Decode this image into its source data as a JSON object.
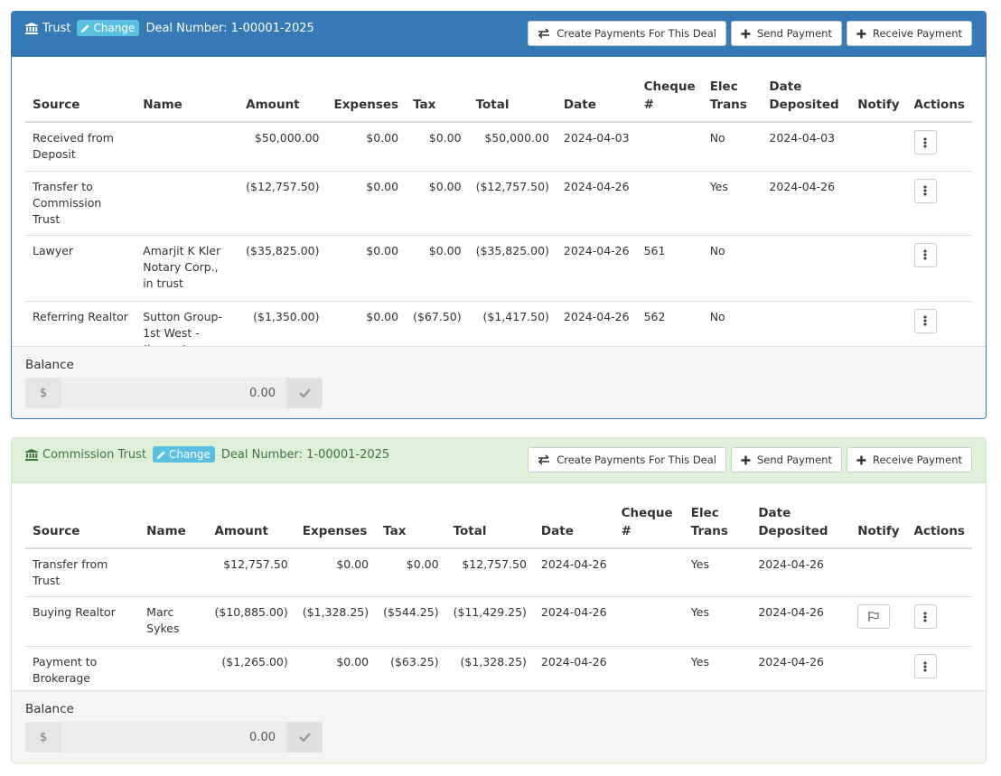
{
  "panels": [
    {
      "heading": {
        "account_name": "Trust",
        "change_label": "Change",
        "deal_number": "Deal Number: 1-00001-2025",
        "buttons": {
          "create_payments": "Create Payments For This Deal",
          "send_payment": "Send Payment",
          "receive_payment": "Receive Payment"
        }
      },
      "columns": [
        "Source",
        "Name",
        "Amount",
        "Expenses",
        "Tax",
        "Total",
        "Date",
        "Cheque #",
        "Elec Trans",
        "Date Deposited",
        "Notify",
        "Actions"
      ],
      "column_lines": {
        "cheque_1": "Cheque",
        "cheque_2": "#",
        "elec_1": "Elec",
        "elec_2": "Trans",
        "deposited_1": "Date",
        "deposited_2": "Deposited"
      },
      "rows": [
        {
          "source": "Received from Deposit",
          "name": "",
          "name_agent": "",
          "amount": "$50,000.00",
          "expenses": "$0.00",
          "tax": "$0.00",
          "total": "$50,000.00",
          "date": "2024-04-03",
          "cheque": "",
          "elec_trans": "No",
          "date_deposited": "2024-04-03",
          "notify": false
        },
        {
          "source": "Transfer to Commission Trust",
          "name": "",
          "name_agent": "",
          "amount": "($12,757.50)",
          "expenses": "$0.00",
          "tax": "$0.00",
          "total": "($12,757.50)",
          "date": "2024-04-26",
          "cheque": "",
          "elec_trans": "Yes",
          "date_deposited": "2024-04-26",
          "notify": false
        },
        {
          "source": "Lawyer",
          "name": "Amarjit K Kler Notary Corp., in trust",
          "name_agent": "",
          "amount": "($35,825.00)",
          "expenses": "$0.00",
          "tax": "$0.00",
          "total": "($35,825.00)",
          "date": "2024-04-26",
          "cheque": "561",
          "elec_trans": "No",
          "date_deposited": "",
          "notify": false
        },
        {
          "source": "Referring Realtor",
          "name": "Sutton Group-1st West - ",
          "name_agent": "Jimmy James",
          "amount": "($1,350.00)",
          "expenses": "$0.00",
          "tax": "($67.50)",
          "total": "($1,417.50)",
          "date": "2024-04-26",
          "cheque": "562",
          "elec_trans": "No",
          "date_deposited": "",
          "notify": false
        }
      ],
      "footer": {
        "balance_label": "Balance",
        "currency_symbol": "$",
        "balance_value": "0.00"
      }
    },
    {
      "heading": {
        "account_name": "Commission Trust",
        "change_label": "Change",
        "deal_number": "Deal Number: 1-00001-2025",
        "buttons": {
          "create_payments": "Create Payments For This Deal",
          "send_payment": "Send Payment",
          "receive_payment": "Receive Payment"
        }
      },
      "columns": [
        "Source",
        "Name",
        "Amount",
        "Expenses",
        "Tax",
        "Total",
        "Date",
        "Cheque #",
        "Elec Trans",
        "Date Deposited",
        "Notify",
        "Actions"
      ],
      "column_lines": {
        "cheque_1": "Cheque",
        "cheque_2": "#",
        "elec_1": "Elec",
        "elec_2": "Trans",
        "deposited_1": "Date",
        "deposited_2": "Deposited"
      },
      "rows": [
        {
          "source": "Transfer from Trust",
          "name": "",
          "amount": "$12,757.50",
          "expenses": "$0.00",
          "tax": "$0.00",
          "total": "$12,757.50",
          "date": "2024-04-26",
          "cheque": "",
          "elec_trans": "Yes",
          "date_deposited": "2024-04-26",
          "notify": false,
          "actions": false
        },
        {
          "source": "Buying Realtor",
          "name": "Marc Sykes",
          "amount": "($10,885.00)",
          "expenses": "($1,328.25)",
          "tax": "($544.25)",
          "total": "($11,429.25)",
          "date": "2024-04-26",
          "cheque": "",
          "elec_trans": "Yes",
          "date_deposited": "2024-04-26",
          "notify": true,
          "actions": true
        },
        {
          "source": "Payment to Brokerage",
          "name": "",
          "amount": "($1,265.00)",
          "expenses": "$0.00",
          "tax": "($63.25)",
          "total": "($1,328.25)",
          "date": "2024-04-26",
          "cheque": "",
          "elec_trans": "Yes",
          "date_deposited": "2024-04-26",
          "notify": false,
          "actions": true
        }
      ],
      "footer": {
        "balance_label": "Balance",
        "currency_symbol": "$",
        "balance_value": "0.00"
      }
    }
  ],
  "icons": {
    "account": "bank-icon",
    "change": "pencil-icon",
    "create_payments": "transfer-arrows-icon",
    "send_payment": "plus-icon",
    "receive_payment": "plus-icon",
    "actions": "vertical-ellipsis-icon",
    "notify": "flag-icon",
    "balance_confirm": "check-icon"
  },
  "colors": {
    "trust_header": "#337ab7",
    "commission_header": "#dff0d8",
    "commission_text": "#3c763d",
    "change_badge": "#5bc0de"
  }
}
